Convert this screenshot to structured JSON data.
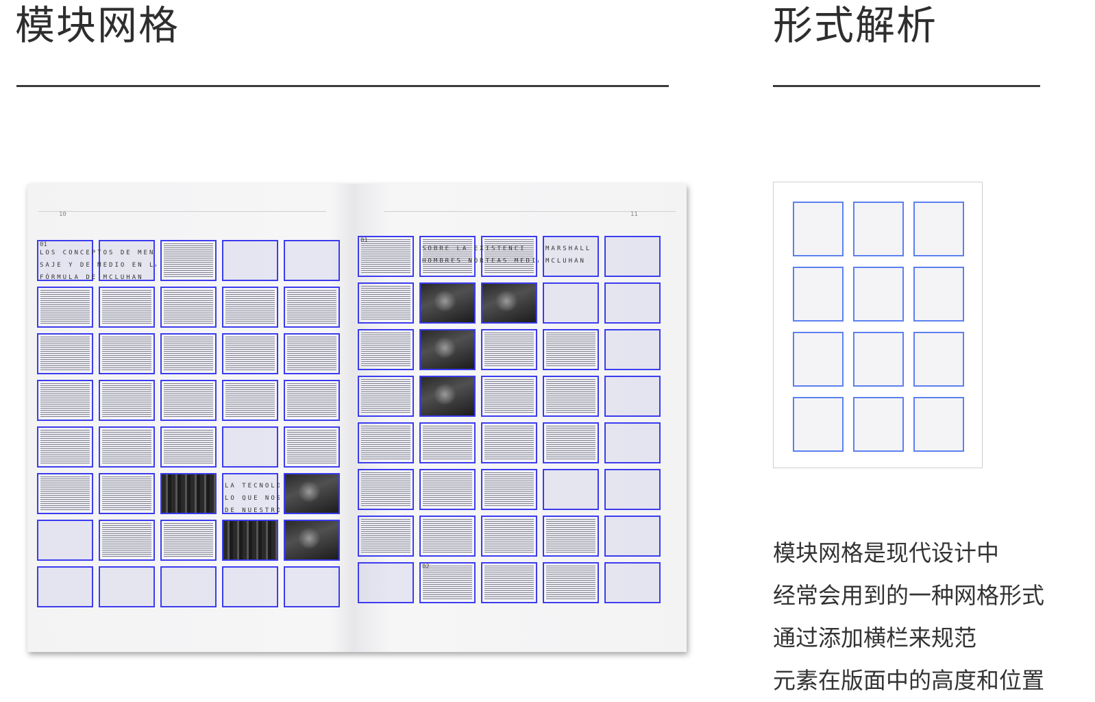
{
  "left_panel": {
    "title": "模块网格"
  },
  "right_panel": {
    "title": "形式解析",
    "description_lines": [
      "模块网格是现代设计中",
      "经常会用到的一种网格形式",
      "通过添加横栏来规范",
      "元素在版面中的高度和位置"
    ]
  },
  "spread": {
    "left_page_number": "10",
    "right_page_number": "11",
    "left_heading_lines": [
      "LOS CONCEPTOS DE MEN",
      "SAJE Y DE MEDIO EN LA",
      "FÓRMULA DE MCLUHAN"
    ],
    "right_heading_lines": [
      "SOBRE LA EXISTENCI",
      "HOMBRES NORTEAS MEDIÁNICOS"
    ],
    "name_tag_lines": [
      "MARSHALL",
      "MCLUHAN"
    ],
    "quote_lines": [
      "LA TECNOLOGÍA ES",
      "LO QUE NOS SEPARA",
      "DE NUESTROS MAYORES"
    ],
    "left_section_number": "01",
    "right_section_number": "01",
    "right_footnote_number": "02",
    "left_grid": {
      "columns": 5,
      "rows": 8
    },
    "right_grid": {
      "columns": 5,
      "rows": 8
    }
  },
  "diagram": {
    "columns": 3,
    "rows": 4
  },
  "colors": {
    "grid_stroke": "#3b3bf0",
    "diagram_stroke": "#5b7ff0",
    "rule": "#3a3a3a"
  }
}
